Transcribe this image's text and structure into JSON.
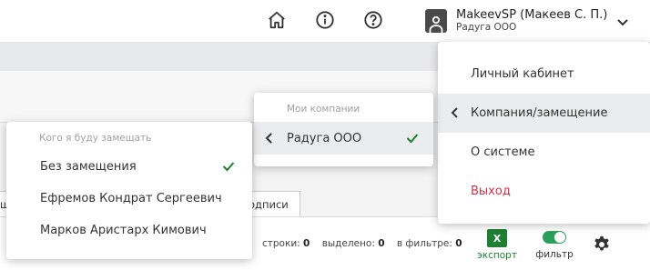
{
  "user": {
    "name": "MakeevSP (Макеев С. П.)",
    "org": "Радуга ООО"
  },
  "user_menu": {
    "items": [
      {
        "label": "Личный кабинет"
      },
      {
        "label": "Компания/замещение"
      },
      {
        "label": "О системе"
      },
      {
        "label": "Выход"
      }
    ]
  },
  "company_menu": {
    "header": "Мои компании",
    "options": [
      {
        "label": "Радуга ООО",
        "selected": true
      }
    ]
  },
  "deputy_menu": {
    "header": "Кого я буду замещать",
    "options": [
      {
        "label": "Без замещения",
        "selected": true
      },
      {
        "label": "Ефремов Кондрат Сергеевич",
        "selected": false
      },
      {
        "label": "Марков Аристарх Кимович",
        "selected": false
      }
    ]
  },
  "tabs": {
    "left_fragment": "ш",
    "right_fragment": "одписи"
  },
  "stats": {
    "rows_label": "строки:",
    "rows_value": "0",
    "selected_label": "выделено:",
    "selected_value": "0",
    "filter_label": "в фильтре:",
    "filter_value": "0"
  },
  "toolbar": {
    "export_icon_text": "X",
    "export_label": "экспорт",
    "filter_label": "фильтр",
    "filter_on": true
  },
  "colors": {
    "accent_green": "#1e7e34",
    "toggle_green": "#2ca05a",
    "logout_red": "#d0334b",
    "active_bg": "#ebeced"
  },
  "icons": [
    "home-icon",
    "info-icon",
    "help-icon",
    "user-avatar-icon",
    "chevron-down-icon",
    "chevron-left-icon",
    "check-icon",
    "gear-icon"
  ]
}
